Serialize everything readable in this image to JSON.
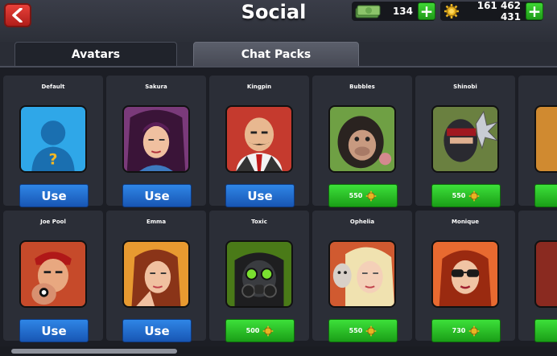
{
  "header": {
    "title": "Social",
    "cash_value": "134",
    "coins_value": "161 462 431",
    "cash_add": "+",
    "coins_add": "+"
  },
  "tabs": [
    {
      "label": "Avatars",
      "active": true
    },
    {
      "label": "Chat Packs",
      "active": false
    }
  ],
  "avatars": [
    {
      "name": "Default",
      "action": "Use",
      "owned": true,
      "icon": "default-silhouette-icon"
    },
    {
      "name": "Sakura",
      "action": "Use",
      "owned": true,
      "icon": "sakura-avatar"
    },
    {
      "name": "Kingpin",
      "action": "Use",
      "owned": true,
      "icon": "kingpin-avatar"
    },
    {
      "name": "Bubbles",
      "action": "550",
      "owned": false,
      "icon": "bubbles-avatar"
    },
    {
      "name": "Shinobi",
      "action": "550",
      "owned": false,
      "icon": "shinobi-avatar"
    },
    {
      "name": "Joe Pool",
      "action": "Use",
      "owned": true,
      "icon": "joe-pool-avatar"
    },
    {
      "name": "Emma",
      "action": "Use",
      "owned": true,
      "icon": "emma-avatar"
    },
    {
      "name": "Toxic",
      "action": "500",
      "owned": false,
      "icon": "toxic-avatar"
    },
    {
      "name": "Ophelia",
      "action": "550",
      "owned": false,
      "icon": "ophelia-avatar"
    },
    {
      "name": "Monique",
      "action": "730",
      "owned": false,
      "icon": "monique-avatar"
    }
  ],
  "colors": {
    "use_button": "#1f6fd0",
    "buy_button": "#2cc427",
    "back_button": "#d0302a"
  }
}
